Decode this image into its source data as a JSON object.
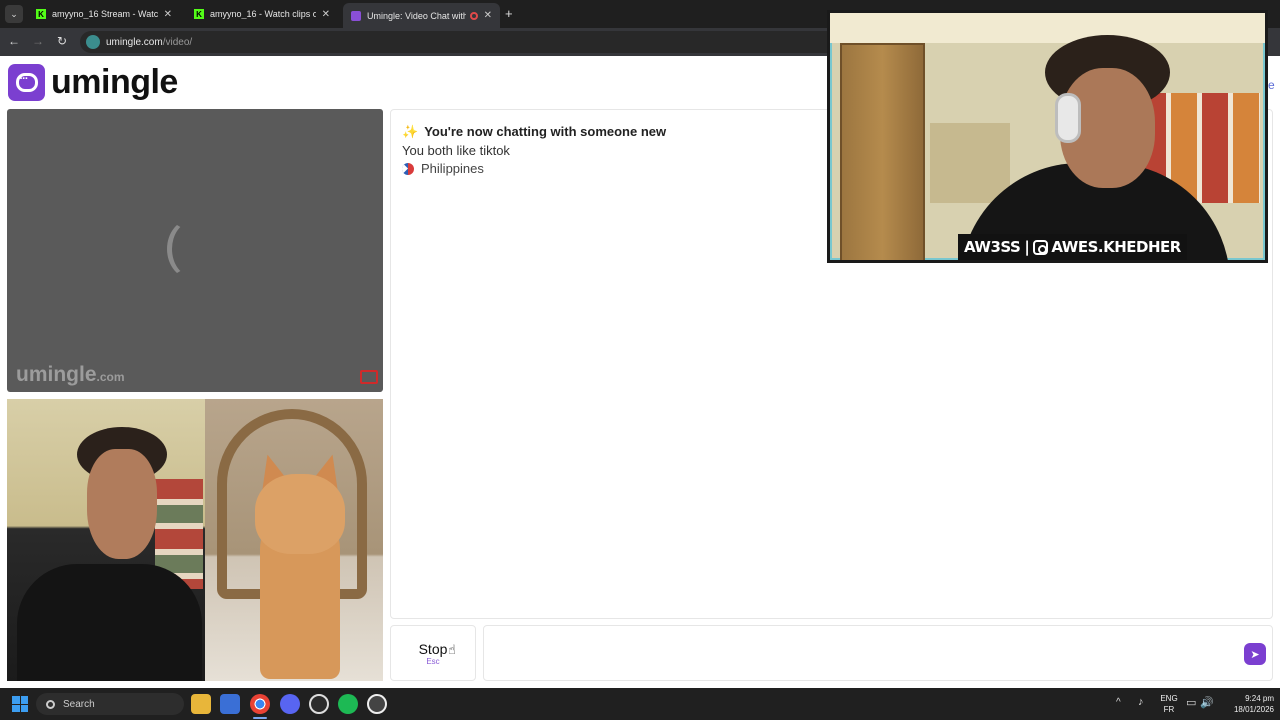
{
  "browser": {
    "tabs": [
      {
        "title": "amyyno_16 Stream - Watch Live",
        "favicon": "kick-icon"
      },
      {
        "title": "amyyno_16 - Watch clips on Ki",
        "favicon": "kick-icon"
      },
      {
        "title": "Umingle: Video Chat with S",
        "favicon": "umingle-icon",
        "active": true
      }
    ],
    "url_host": "umingle.com",
    "url_path": "/video/"
  },
  "page": {
    "logo_text": "umingle",
    "watermark_main": "umingle",
    "watermark_suffix": ".com",
    "messages": {
      "line1": "You're now chatting with someone new",
      "line2": "You both like tiktok",
      "country": "Philippines"
    },
    "stop_button": {
      "label": "Stop",
      "hint": "Esc"
    },
    "message_input": {
      "placeholder": ""
    },
    "accent_color": "#7b3fd0"
  },
  "overlay": {
    "handle_left": "AW3SS",
    "handle_right": "AWES.KHEDHER",
    "peek_text": "e"
  },
  "taskbar": {
    "search_label": "Search",
    "lang_top": "ENG",
    "lang_bottom": "FR",
    "time": "9:24 pm",
    "date": "18/01/2026"
  }
}
